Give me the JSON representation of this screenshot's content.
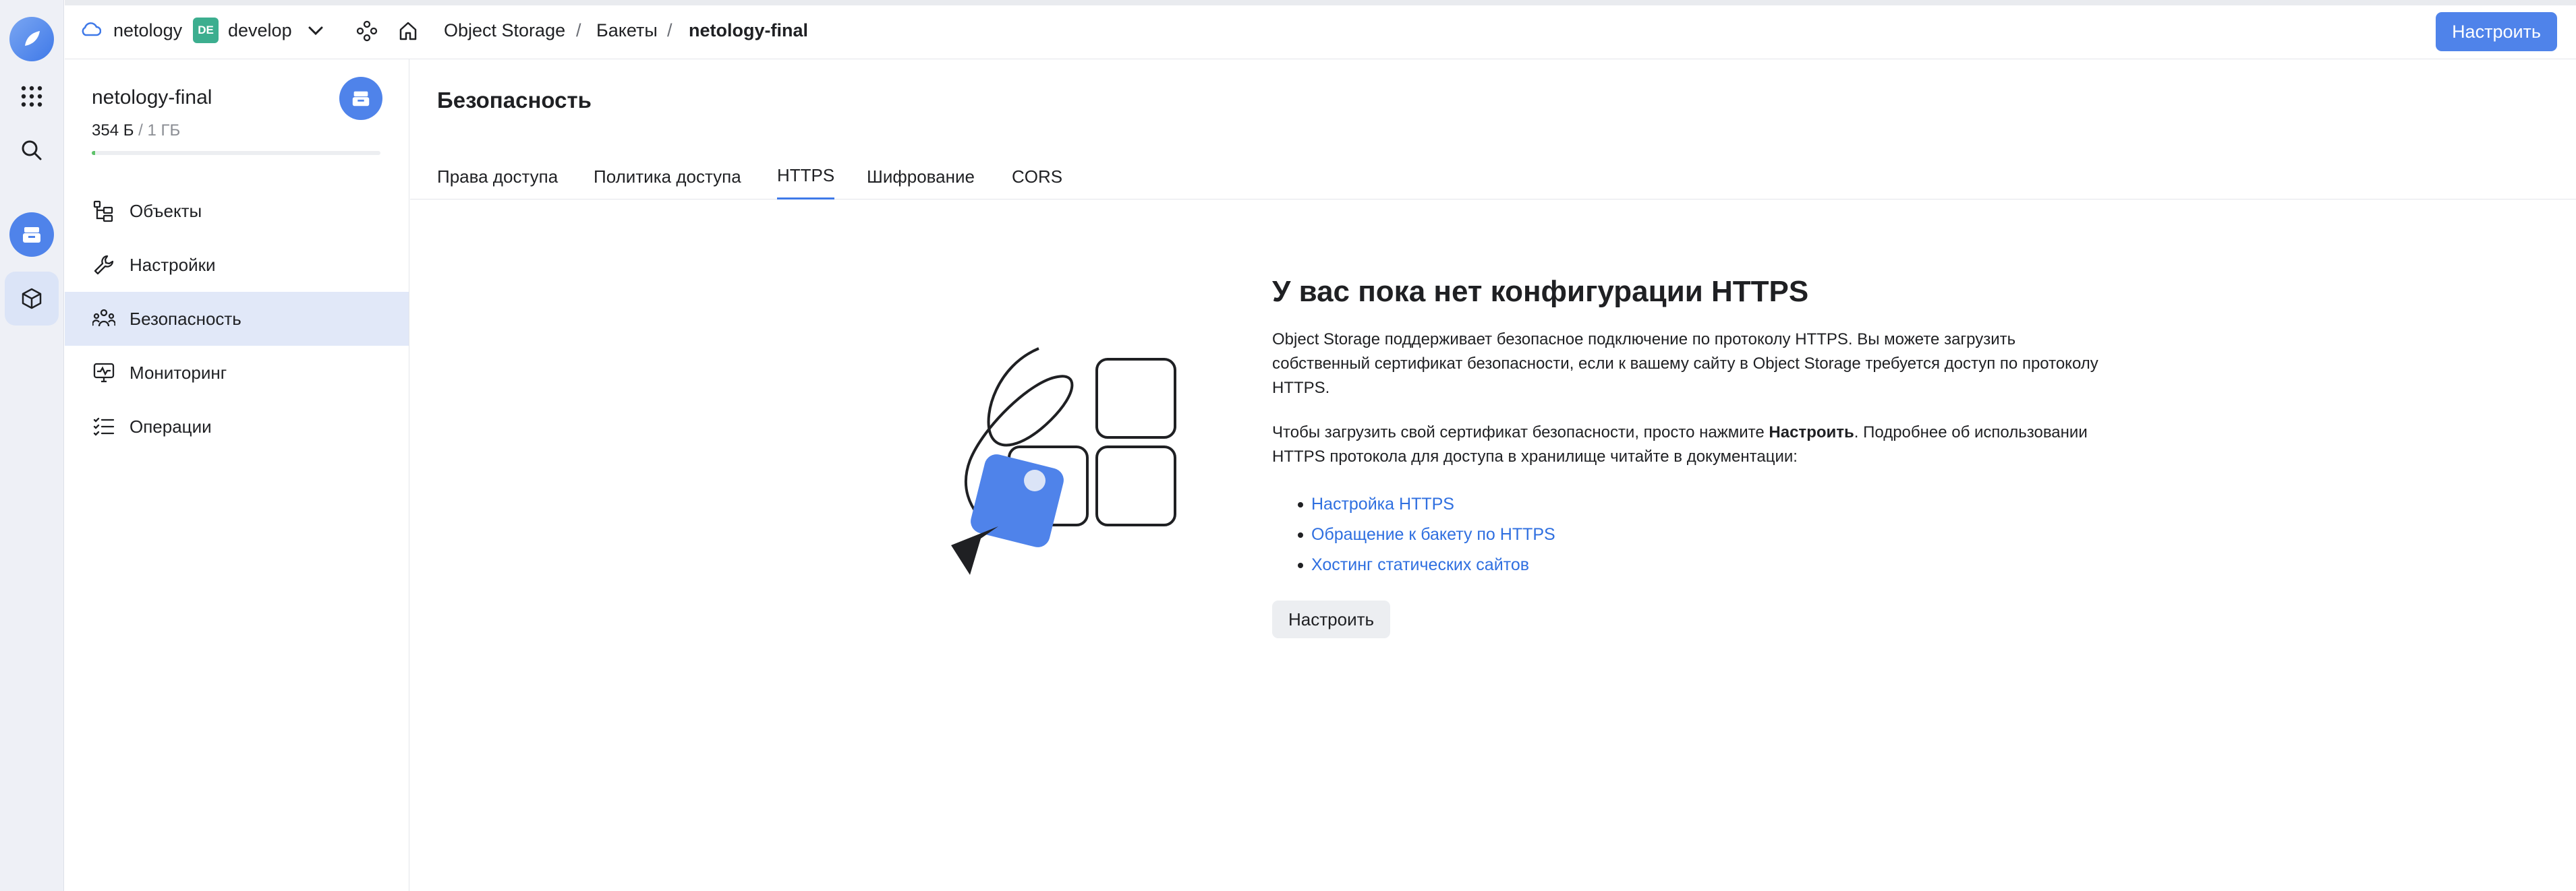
{
  "topbar": {
    "cloud": "netology",
    "folder_badge": "DE",
    "folder": "develop",
    "breadcrumbs": [
      "Object Storage",
      "Бакеты",
      "netology-final"
    ],
    "action_label": "Настроить"
  },
  "sidebar": {
    "bucket_name": "netology-final",
    "usage_used": "354 Б",
    "usage_total": " / 1 ГБ",
    "usage_fraction": 0.012,
    "items": [
      {
        "label": "Объекты",
        "icon": "objects-icon"
      },
      {
        "label": "Настройки",
        "icon": "wrench-icon"
      },
      {
        "label": "Безопасность",
        "icon": "users-icon",
        "active": true
      },
      {
        "label": "Мониторинг",
        "icon": "monitor-icon"
      },
      {
        "label": "Операции",
        "icon": "list-icon"
      }
    ]
  },
  "main": {
    "title": "Безопасность",
    "tabs": [
      "Права доступа",
      "Политика доступа",
      "HTTPS",
      "Шифрование",
      "CORS"
    ],
    "active_tab": "HTTPS",
    "empty": {
      "heading": "У вас пока нет конфигурации HTTPS",
      "p1": "Object Storage поддерживает безопасное подключение по протоколу HTTPS. Вы можете загрузить собственный сертификат безопасности, если к вашему сайту в Object Storage требуется доступ по протоколу HTTPS.",
      "p2_before": "Чтобы загрузить свой сертификат безопасности, просто нажмите ",
      "p2_bold": "Настроить",
      "p2_after": ". Подробнее об использовании HTTPS протокола для доступа в хранилище читайте в документации:",
      "links": [
        "Настройка HTTPS",
        "Обращение к бакету по HTTPS",
        "Хостинг статических сайтов"
      ],
      "button": "Настроить"
    }
  },
  "colors": {
    "accent": "#4f83ea",
    "link": "#2f6fe0",
    "active_bg": "#e1e8f8",
    "badge": "#3cae8f",
    "usage": "#5ec26a"
  }
}
